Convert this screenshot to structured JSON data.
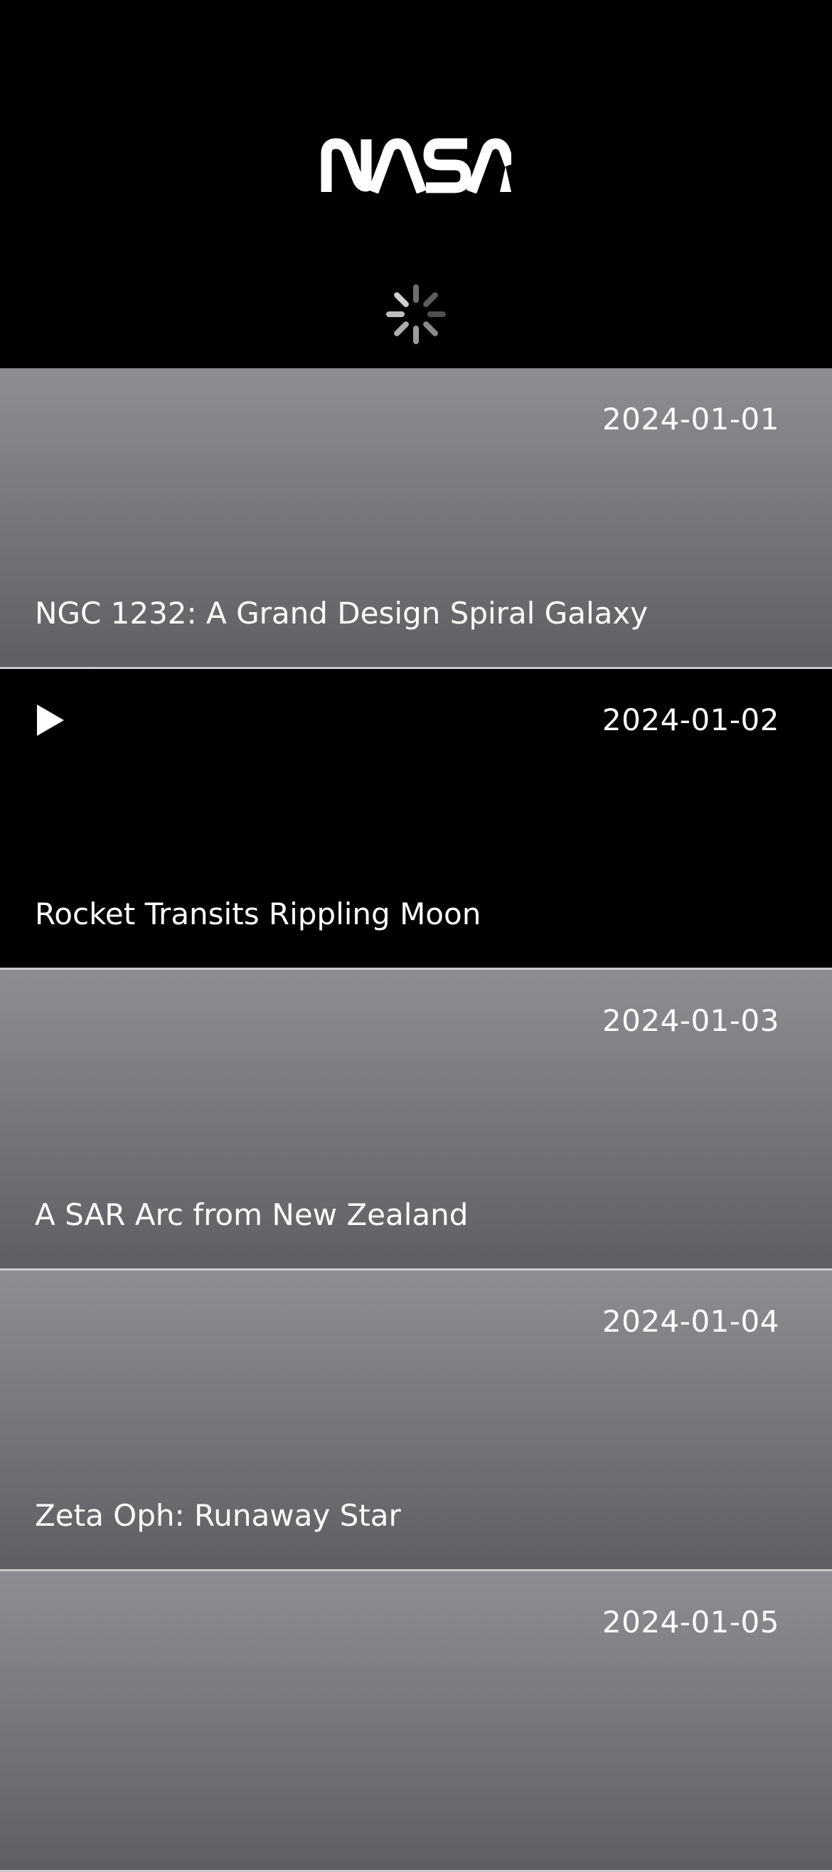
{
  "header": {
    "logo_text": "NASA",
    "logo_icon": "nasa-worm-logo",
    "spinner_icon": "activity-spinner"
  },
  "feed": {
    "items": [
      {
        "date": "2024-01-01",
        "title": "NGC 1232: A Grand Design Spiral Galaxy",
        "media": "image"
      },
      {
        "date": "2024-01-02",
        "title": "Rocket Transits Rippling Moon",
        "media": "video",
        "icon": "play-icon"
      },
      {
        "date": "2024-01-03",
        "title": "A SAR Arc from New Zealand",
        "media": "image"
      },
      {
        "date": "2024-01-04",
        "title": "Zeta Oph: Runaway Star",
        "media": "image"
      },
      {
        "date": "2024-01-05",
        "title": "",
        "media": "image"
      }
    ]
  },
  "colors": {
    "background": "#000000",
    "card_gradient_top": "#8e8d92",
    "card_gradient_bottom": "#5f5f63",
    "divider": "#c9c9cb",
    "text": "#ffffff"
  }
}
